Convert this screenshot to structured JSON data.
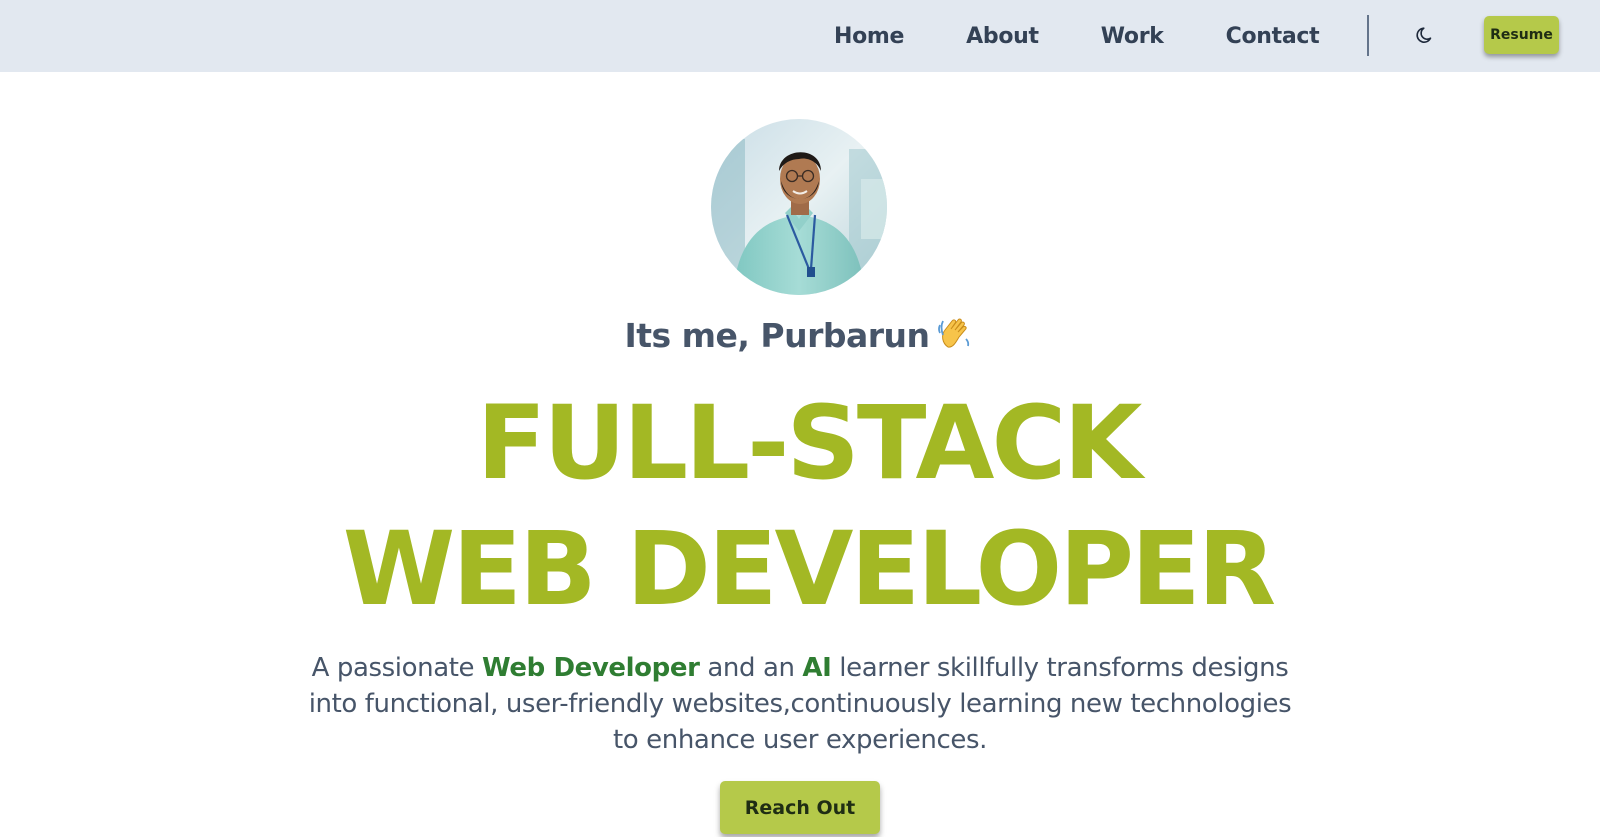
{
  "nav": {
    "links": [
      {
        "label": "Home"
      },
      {
        "label": "About"
      },
      {
        "label": "Work"
      },
      {
        "label": "Contact"
      }
    ],
    "theme_toggle_icon": "moon-icon",
    "resume_label": "Resume"
  },
  "hero": {
    "avatar_icon": "profile-photo",
    "greeting": "Its me, Purbarun",
    "greeting_emoji_icon": "waving-hand-icon",
    "headline_line1": "FULL-STACK",
    "headline_line2": "WEB DEVELOPER",
    "description": {
      "part1": "A passionate ",
      "highlight1": "Web Developer",
      "part2": " and an ",
      "highlight2": "AI",
      "part3": " learner skillfully transforms designs into functional, user-friendly websites,continuously learning new technologies to enhance user experiences."
    },
    "cta_label": "Reach Out"
  },
  "colors": {
    "nav_bg": "#e2e8f0",
    "accent": "#a3b824",
    "button": "#b5c94a",
    "highlight": "#2f7d32",
    "text": "#475569"
  }
}
